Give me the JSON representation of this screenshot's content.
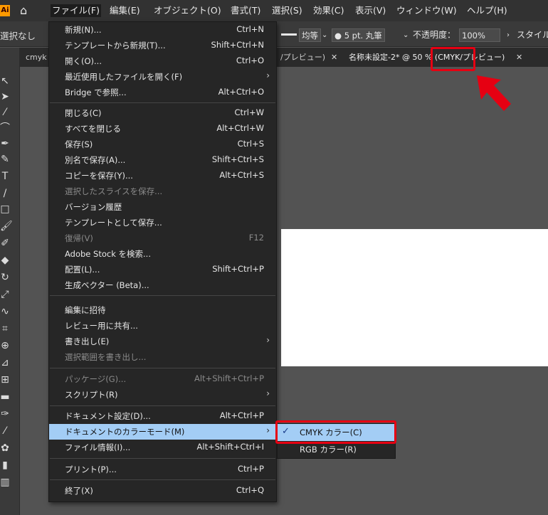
{
  "app": {
    "logo": "Ai"
  },
  "menubar": {
    "items": [
      "ファイル(F)",
      "編集(E)",
      "オブジェクト(O)",
      "書式(T)",
      "選択(S)",
      "効果(C)",
      "表示(V)",
      "ウィンドウ(W)",
      "ヘルプ(H)"
    ]
  },
  "controlbar": {
    "selection": "選択なし",
    "stroke_profile": "均等",
    "brush": "5 pt. 丸筆",
    "opacity_label": "不透明度：",
    "opacity_value": "100%",
    "style_label": "スタイル"
  },
  "tabs": [
    {
      "title": "cmyk"
    },
    {
      "title": "/プレビュー)"
    },
    {
      "title": "名称未設定-2* @ 50 % (CMYK/プレビュー)"
    }
  ],
  "file_menu": {
    "items": [
      {
        "label": "新規(N)...",
        "shortcut": "Ctrl+N"
      },
      {
        "label": "テンプレートから新規(T)...",
        "shortcut": "Shift+Ctrl+N"
      },
      {
        "label": "開く(O)...",
        "shortcut": "Ctrl+O"
      },
      {
        "label": "最近使用したファイルを開く(F)",
        "shortcut": ""
      },
      {
        "label": "Bridge で参照...",
        "shortcut": "Alt+Ctrl+O"
      },
      {
        "label": "閉じる(C)",
        "shortcut": "Ctrl+W"
      },
      {
        "label": "すべてを閉じる",
        "shortcut": "Alt+Ctrl+W"
      },
      {
        "label": "保存(S)",
        "shortcut": "Ctrl+S"
      },
      {
        "label": "別名で保存(A)...",
        "shortcut": "Shift+Ctrl+S"
      },
      {
        "label": "コピーを保存(Y)...",
        "shortcut": "Alt+Ctrl+S"
      },
      {
        "label": "選択したスライスを保存...",
        "shortcut": ""
      },
      {
        "label": "バージョン履歴",
        "shortcut": ""
      },
      {
        "label": "テンプレートとして保存...",
        "shortcut": ""
      },
      {
        "label": "復帰(V)",
        "shortcut": "F12"
      },
      {
        "label": "Adobe Stock を検索...",
        "shortcut": ""
      },
      {
        "label": "配置(L)...",
        "shortcut": "Shift+Ctrl+P"
      },
      {
        "label": "生成ベクター (Beta)...",
        "shortcut": ""
      },
      {
        "label": "編集に招待",
        "shortcut": ""
      },
      {
        "label": "レビュー用に共有...",
        "shortcut": ""
      },
      {
        "label": "書き出し(E)",
        "shortcut": ""
      },
      {
        "label": "選択範囲を書き出し...",
        "shortcut": ""
      },
      {
        "label": "パッケージ(G)...",
        "shortcut": "Alt+Shift+Ctrl+P"
      },
      {
        "label": "スクリプト(R)",
        "shortcut": ""
      },
      {
        "label": "ドキュメント設定(D)...",
        "shortcut": "Alt+Ctrl+P"
      },
      {
        "label": "ドキュメントのカラーモード(M)",
        "shortcut": ""
      },
      {
        "label": "ファイル情報(I)...",
        "shortcut": "Alt+Shift+Ctrl+I"
      },
      {
        "label": "プリント(P)...",
        "shortcut": "Ctrl+P"
      },
      {
        "label": "終了(X)",
        "shortcut": "Ctrl+Q"
      }
    ]
  },
  "color_mode_submenu": {
    "cmyk": "CMYK カラー(C)",
    "rgb": "RGB カラー(R)"
  },
  "colors": {
    "highlight": "#a3cdf5",
    "annotation_red": "#e60012",
    "logo_orange": "#ff9a00"
  }
}
